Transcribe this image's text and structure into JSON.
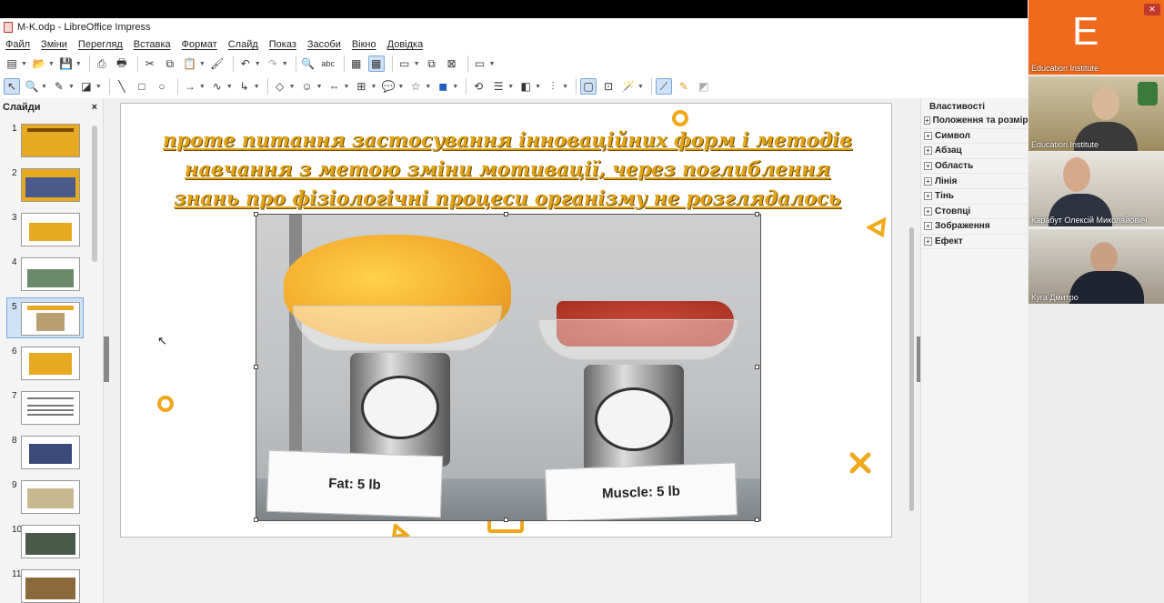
{
  "window": {
    "title": "M-K.odp - LibreOffice Impress"
  },
  "menu": [
    "Файл",
    "Зміни",
    "Перегляд",
    "Вставка",
    "Формат",
    "Слайд",
    "Показ",
    "Засоби",
    "Вікно",
    "Довідка"
  ],
  "slides_panel": {
    "title": "Слайди",
    "close": "×",
    "slides": [
      {
        "num": "1"
      },
      {
        "num": "2"
      },
      {
        "num": "3"
      },
      {
        "num": "4"
      },
      {
        "num": "5",
        "selected": true
      },
      {
        "num": "6"
      },
      {
        "num": "7"
      },
      {
        "num": "8"
      },
      {
        "num": "9"
      },
      {
        "num": "10"
      },
      {
        "num": "11"
      }
    ]
  },
  "slide": {
    "title": "проте питання застосування інноваційних форм і методів навчання з метою зміни мотивації, через поглиблення знань про фізіологічні процеси організму не розглядалось раніше",
    "card_fat": "Fat: 5 lb",
    "card_muscle": "Muscle: 5 lb",
    "accent_color": "#f0a81b"
  },
  "properties": {
    "title": "Властивості",
    "sections": [
      "Положення та розмір",
      "Символ",
      "Абзац",
      "Область",
      "Лінія",
      "Тінь",
      "Стовпці",
      "Зображення",
      "Ефект"
    ]
  },
  "participants": [
    {
      "name": "Education Institute",
      "avatar_letter": "E"
    },
    {
      "name": "Education Institute"
    },
    {
      "name": "Карабут Олексій Миколайович"
    },
    {
      "name": "Куга Дмитро"
    }
  ]
}
